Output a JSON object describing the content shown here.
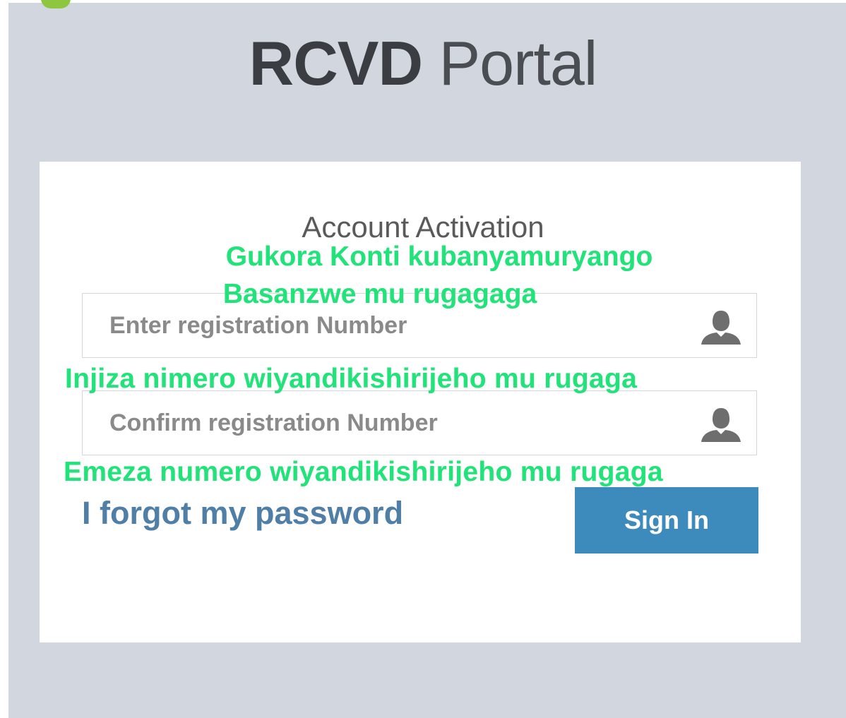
{
  "header": {
    "brand": "RCVD",
    "title_word": "Portal"
  },
  "card": {
    "heading": "Account Activation",
    "registration_field": {
      "placeholder": "Enter registration Number",
      "value": ""
    },
    "confirm_field": {
      "placeholder": "Confirm registration Number",
      "value": ""
    },
    "forgot_link": "I forgot my password",
    "signin_label": "Sign In"
  },
  "annotations": {
    "line1": "Gukora Konti kubanyamuryango",
    "line2": "Basanzwe mu rugagaga",
    "line3": "Injiza nimero wiyandikishirijeho mu rugaga",
    "line4": "Emeza numero wiyandikishirijeho mu rugaga"
  },
  "icons": {
    "field_icon": "user-icon"
  },
  "colors": {
    "background": "#d1d6df",
    "button": "#3d8bbd",
    "link": "#4f7ea6",
    "annotation": "#22e27a",
    "badge": "#8dc63f"
  }
}
